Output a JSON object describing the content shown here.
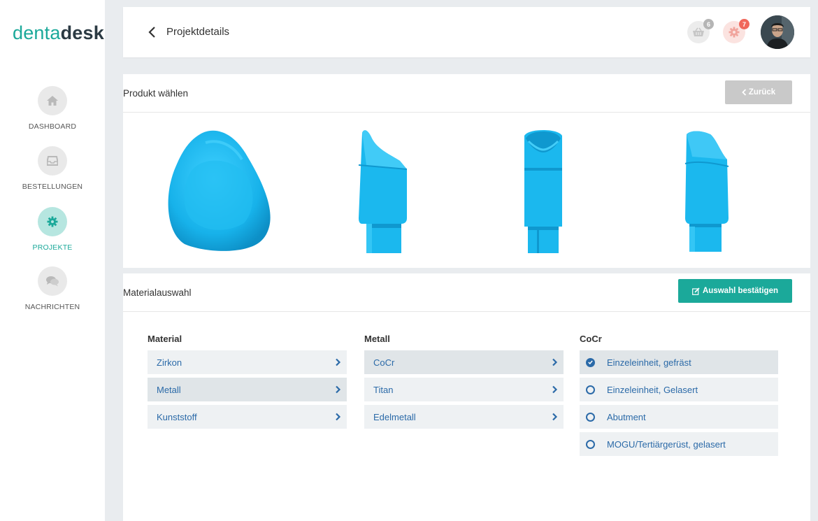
{
  "app": {
    "logo_part1": "denta",
    "logo_part2": "desk"
  },
  "sidebar": {
    "items": [
      {
        "label": "DASHBOARD",
        "icon": "home-icon",
        "active": false
      },
      {
        "label": "BESTELLUNGEN",
        "icon": "inbox-icon",
        "active": false
      },
      {
        "label": "PROJEKTE",
        "icon": "gear-icon",
        "active": true
      },
      {
        "label": "NACHRICHTEN",
        "icon": "chat-bubbles-icon",
        "active": false
      }
    ]
  },
  "header": {
    "title": "Projektdetails",
    "cart_count": "6",
    "settings_count": "7"
  },
  "product_section": {
    "title": "Produkt wählen",
    "back_label": "Zurück",
    "products": [
      "crown",
      "abutment-side",
      "abutment-front",
      "abutment-angled"
    ]
  },
  "material_section": {
    "title": "Materialauswahl",
    "confirm_label": "Auswahl bestätigen",
    "columns": [
      {
        "heading": "Material",
        "items": [
          {
            "label": "Zirkon",
            "selected": false
          },
          {
            "label": "Metall",
            "selected": true
          },
          {
            "label": "Kunststoff",
            "selected": false
          }
        ]
      },
      {
        "heading": "Metall",
        "items": [
          {
            "label": "CoCr",
            "selected": true
          },
          {
            "label": "Titan",
            "selected": false
          },
          {
            "label": "Edelmetall",
            "selected": false
          }
        ]
      },
      {
        "heading": "CoCr",
        "items": [
          {
            "label": "Einzeleinheit, gefräst",
            "checked": true
          },
          {
            "label": "Einzeleinheit, Gelasert",
            "checked": false
          },
          {
            "label": "Abutment",
            "checked": false
          },
          {
            "label": "MOGU/Tertiärgerüst, gelasert",
            "checked": false
          }
        ]
      }
    ]
  },
  "colors": {
    "accent": "#1ba99a",
    "link": "#2b6aa8",
    "product": "#1bb8ee",
    "badge_red": "#f0675b"
  }
}
